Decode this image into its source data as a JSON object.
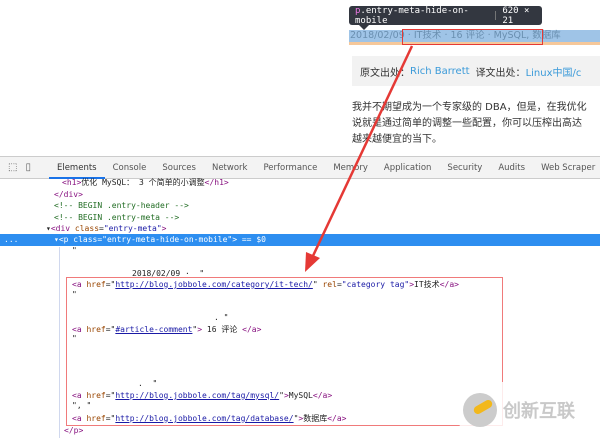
{
  "page": {
    "tooltip": {
      "selector_tag": "p",
      "selector_class": ".entry-meta-hide-on-mobile",
      "size": "620 × 21"
    },
    "meta_line": "2018/02/09 · IT技术 · 16 评论 · MySQL, 数据库",
    "quote": {
      "source_label": "原文出处：",
      "source_author": "Rich Barrett",
      "translation_label": "译文出处：",
      "translation_source": "Linux中国/c"
    },
    "paragraph": [
      "我并不期望成为一个专家级的 DBA，但是，在我优化",
      "说就是通过简单的调整一些配置，你可以压榨出高达",
      "越来越便宜的当下。"
    ]
  },
  "devtools": {
    "tabs": [
      "Elements",
      "Console",
      "Sources",
      "Network",
      "Performance",
      "Memory",
      "Application",
      "Security",
      "Audits",
      "Web Scraper"
    ],
    "active_tab": "Elements",
    "lines": {
      "h1_text": "优化 MySQL： 3 个简单的小调整",
      "comment1": "<!-- BEGIN .entry-header -->",
      "comment2": "<!-- BEGIN .entry-meta -->",
      "div_class": "entry-meta",
      "p_class": "entry-meta-hide-on-mobile",
      "selected_suffix": " == $0",
      "date_text": "2018/02/09 ·  \"",
      "a1_href": "http://blog.jobbole.com/category/it-tech/",
      "a1_rel": "category tag",
      "a1_text": "IT技术",
      "a2_href": "#article-comment",
      "a2_text": " 16 评论 ",
      "a3_href": "http://blog.jobbole.com/tag/mysql/",
      "a3_text": "MySQL",
      "comma_text": "\", \"",
      "a4_href": "http://blog.jobbole.com/tag/database/",
      "a4_text": "数据库"
    }
  },
  "watermark": {
    "text": "创新互联"
  },
  "colors": {
    "selection": "#2d8ef0",
    "highlight": "#9fc4e7",
    "annotation_red": "#e53935",
    "link": "#3a9ad9"
  }
}
